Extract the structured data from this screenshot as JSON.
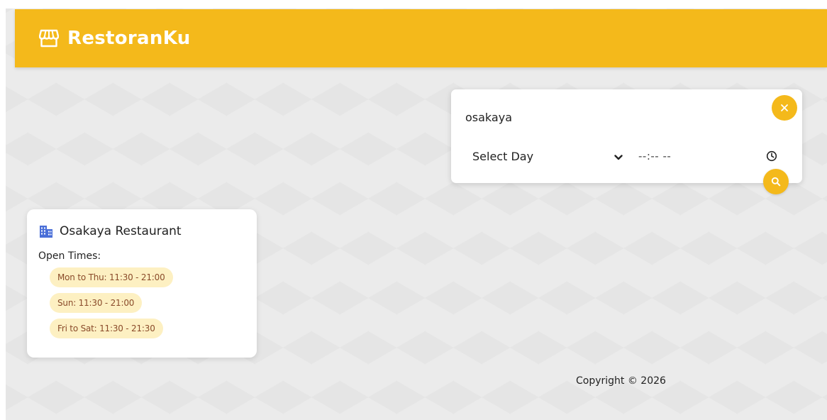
{
  "app": {
    "brand": "RestoranKu",
    "brand_icon": "store-icon",
    "accent_color": "#f4b91b"
  },
  "search": {
    "query": "osakaya",
    "day_select_value": "Select Day",
    "time_value": "--:-- --",
    "clear_icon": "close-icon",
    "search_icon": "search-icon",
    "clock_icon": "clock-icon"
  },
  "results": [
    {
      "icon": "building-icon",
      "name": "Osakaya Restaurant",
      "open_times_label": "Open Times:",
      "times": [
        "Mon to Thu: 11:30 - 21:00",
        "Sun: 11:30 - 21:00",
        "Fri to Sat: 11:30 - 21:30"
      ]
    }
  ],
  "footer": {
    "copyright": "Copyright © 2026"
  }
}
